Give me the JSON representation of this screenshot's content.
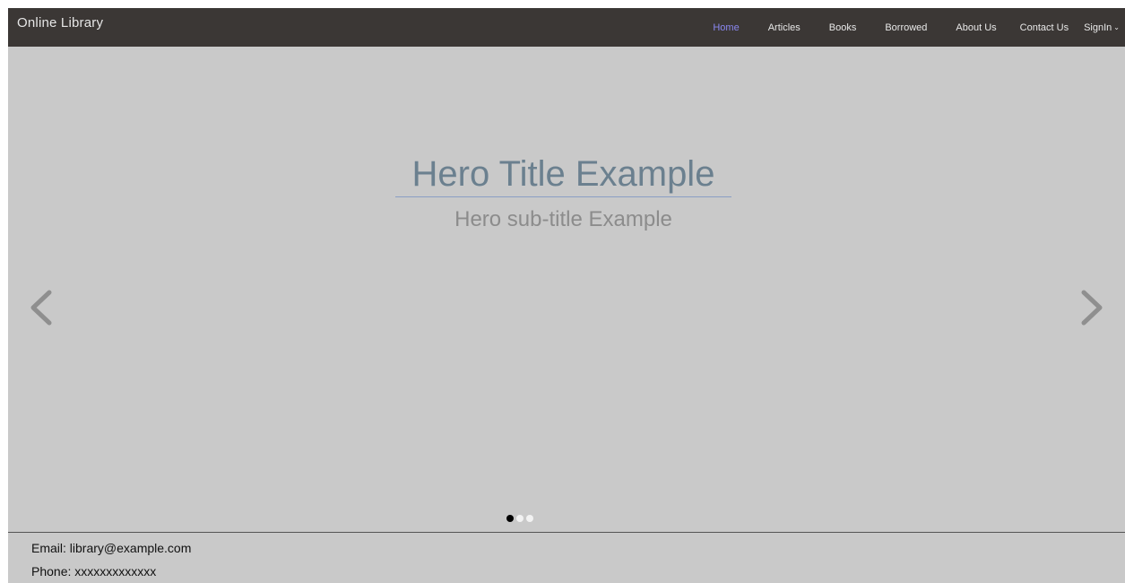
{
  "navbar": {
    "brand": "Online Library",
    "links": [
      "Home",
      "Articles",
      "Books",
      "Borrowed",
      "About Us",
      "Contact Us"
    ],
    "signin_label": "SignIn",
    "active_link": "Home"
  },
  "hero": {
    "title": "Hero Title Example",
    "subtitle": "Hero sub-title Example",
    "prev_icon": "chevron-left-icon",
    "next_icon": "chevron-right-icon",
    "slide_count": 3,
    "active_slide": 1
  },
  "footer": {
    "email": "Email: library@example.com",
    "phone": "Phone: xxxxxxxxxxxxx"
  },
  "colors": {
    "navbar_bg": "#3b3735",
    "active_link": "#8a87f0",
    "hero_bg": "#c9c9c9",
    "hero_title": "#6b808f",
    "hero_subtitle": "#8c8c8c"
  }
}
